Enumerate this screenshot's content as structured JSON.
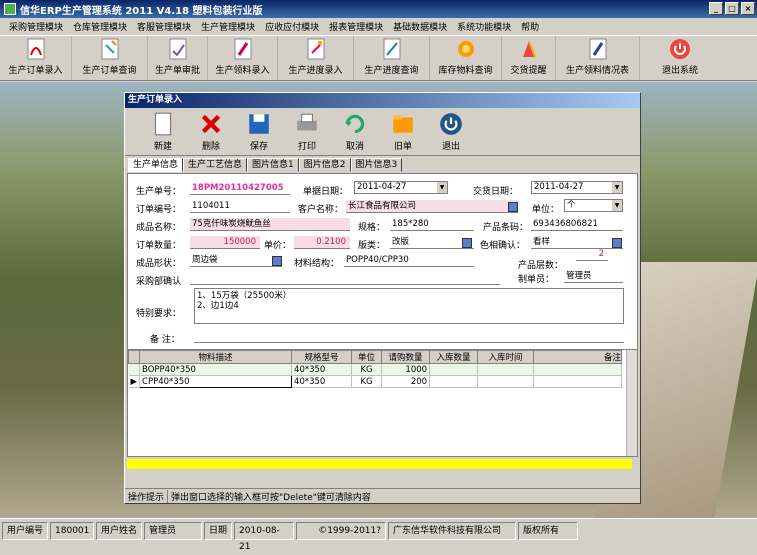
{
  "app": {
    "title": "信华ERP生产管理系统  2011 V4.18  塑料包装行业版"
  },
  "window_buttons": [
    "_",
    "□",
    "×"
  ],
  "menu": [
    "采购管理模块",
    "仓库管理模块",
    "客服管理模块",
    "生产管理模块",
    "应收应付模块",
    "报表管理模块",
    "基础数据模块",
    "系统功能模块",
    "帮助"
  ],
  "toolbar": [
    "生产订单录入",
    "生产订单查询",
    "生产单审批",
    "生产领料录入",
    "生产进度录入",
    "生产进度查询",
    "库存物料查询",
    "交货提醒",
    "生产领料情况表",
    "退出系统"
  ],
  "dialog": {
    "title": "生产订单录入",
    "tools": [
      "新建",
      "删除",
      "保存",
      "打印",
      "取消",
      "旧单",
      "退出"
    ],
    "tabs": [
      "生产单信息",
      "生产工艺信息",
      "图片信息1",
      "图片信息2",
      "图片信息3"
    ],
    "form": {
      "order_no_label": "生产单号：",
      "order_no": "18PM20110427005",
      "doc_date_label": "单据日期：",
      "doc_date": "2011-04-27",
      "delivery_label": "交货日期：",
      "delivery": "2011-04-27",
      "sales_no_label": "订单编号：",
      "sales_no": "1104011",
      "customer_label": "客户名称：",
      "customer": "长江食品有限公司",
      "unit_label": "单位：",
      "unit": "个",
      "product_label": "成品名称：",
      "product": "75克仟味炭烧鱿鱼丝",
      "spec_label": "规格：",
      "spec": "185*280",
      "barcode_label": "产品条码：",
      "barcode": "693436806821",
      "qty_label": "订单数量：",
      "qty": "150000",
      "price_label": "单价：",
      "price": "0.2100",
      "plate_label": "版类：",
      "plate": "改版",
      "color_label": "色相确认：",
      "color": "看样",
      "shape_label": "成品形状：",
      "shape": "周边袋",
      "structure_label": "材料结构：",
      "structure": "POPP40/CPP30",
      "layers_label": "产品层数：",
      "layers": "2",
      "purchase_label": "采购部确认",
      "maker_label": "制单员：",
      "maker": "管理员",
      "special_label": "特别要求：",
      "special": "1、15万袋（25500米）\n2、边1边4",
      "remark_label": "备  注："
    },
    "grid": {
      "headers": [
        "物料描述",
        "规格型号",
        "单位",
        "请购数量",
        "入库数量",
        "入库时间",
        "备注"
      ],
      "rows": [
        [
          "BOPP40*350",
          "40*350",
          "KG",
          "1000",
          "",
          "",
          ""
        ],
        [
          "CPP40*350",
          "40*350",
          "KG",
          "200",
          "",
          "",
          ""
        ]
      ]
    },
    "hint_label": "操作提示",
    "hint": "弹出窗口选择的输入框可按\"Delete\"键可清除内容"
  },
  "status": {
    "user_id_label": "用户编号",
    "user_id": "180001",
    "user_name_label": "用户姓名",
    "user_name": "管理员",
    "date_label": "日期",
    "date": "2010-08-21",
    "copyright": "©1999-2011?",
    "company": "广东信华软件科技有限公司",
    "rights": "版权所有"
  },
  "colors": {
    "title_bar": "#0a246a",
    "highlight_red": "#e0309a",
    "pink_field": "#f8dde4",
    "grid_total": "#ffff00"
  }
}
